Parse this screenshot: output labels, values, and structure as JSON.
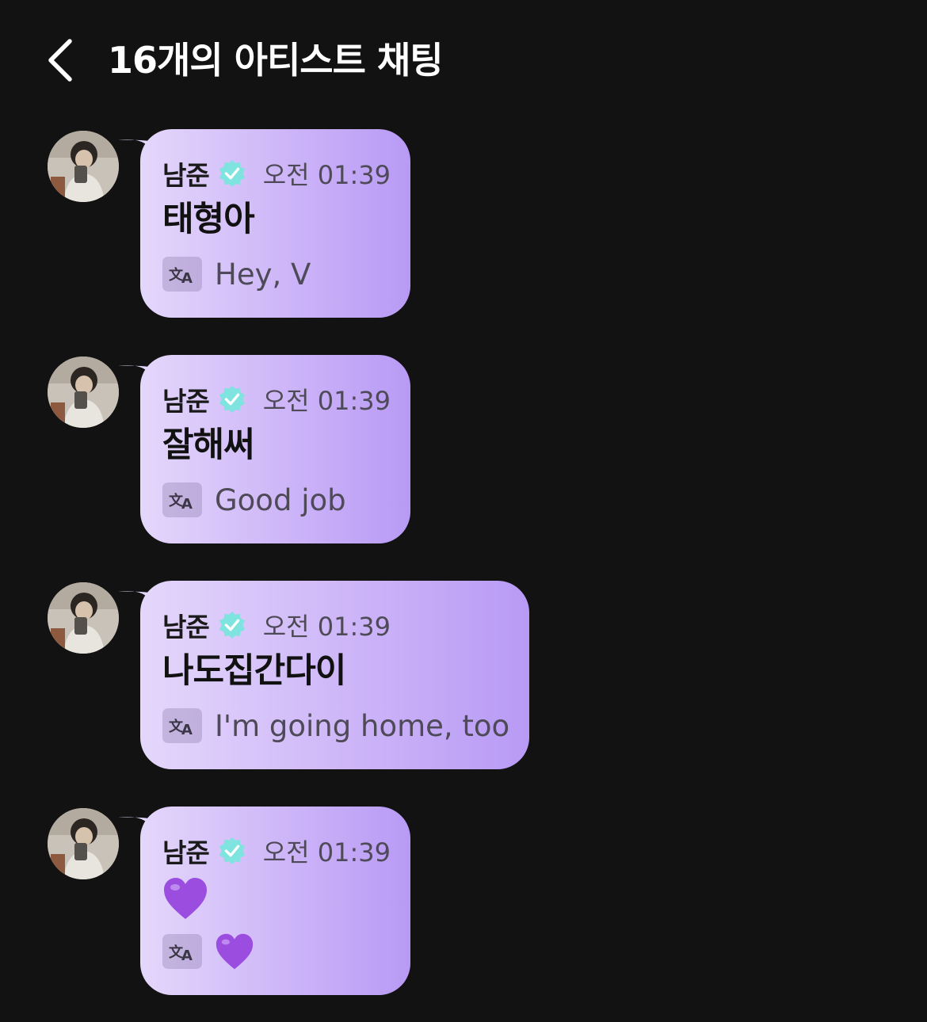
{
  "header": {
    "title": "16개의 아티스트 채팅",
    "back_icon": "chevron-left-icon"
  },
  "colors": {
    "background": "#121212",
    "bubble_start": "#e4d7fb",
    "bubble_end": "#b89af5",
    "verified_badge": "#7fe3e0",
    "heart": "#9b4de0"
  },
  "messages": [
    {
      "sender": "남준",
      "verified": true,
      "time": "오전 01:39",
      "text": "태형아",
      "translation": "Hey, V"
    },
    {
      "sender": "남준",
      "verified": true,
      "time": "오전 01:39",
      "text": "잘해써",
      "translation": "Good job"
    },
    {
      "sender": "남준",
      "verified": true,
      "time": "오전 01:39",
      "text": "나도집간다이",
      "translation": "I'm going home, too"
    },
    {
      "sender": "남준",
      "verified": true,
      "time": "오전 01:39",
      "text": "💜",
      "translation": "💜",
      "is_emoji": true
    }
  ]
}
